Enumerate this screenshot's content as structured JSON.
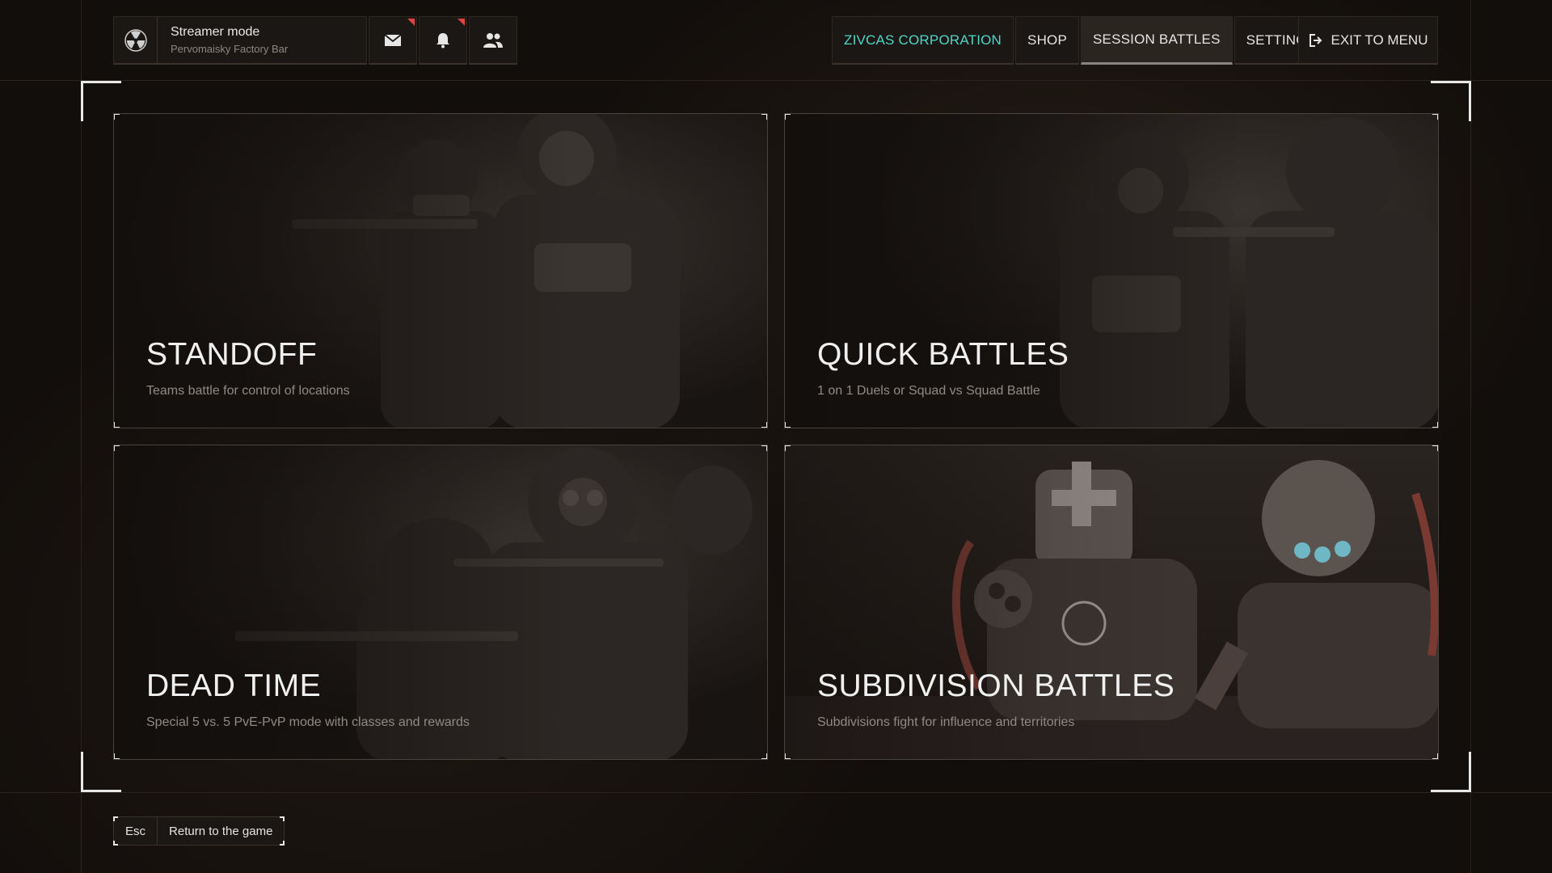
{
  "profile": {
    "name": "Streamer mode",
    "location": "Pervomaisky Factory Bar",
    "avatar_icon": "radiation-icon"
  },
  "header_icons": [
    {
      "name": "mail-icon",
      "has_notification": true
    },
    {
      "name": "bell-icon",
      "has_notification": true
    },
    {
      "name": "friends-icon",
      "has_notification": false
    }
  ],
  "nav": {
    "items": [
      {
        "label": "ZIVCAS CORPORATION",
        "accent": true
      },
      {
        "label": "SHOP"
      },
      {
        "label": "SESSION BATTLES",
        "active": true
      },
      {
        "label": "SETTINGS"
      }
    ],
    "exit_label": "EXIT TO MENU",
    "exit_icon": "exit-icon"
  },
  "modes": [
    {
      "title": "STANDOFF",
      "description": "Teams battle for control of locations"
    },
    {
      "title": "QUICK BATTLES",
      "description": "1 on 1 Duels or Squad vs Squad Battle"
    },
    {
      "title": "DEAD TIME",
      "description": "Special 5 vs. 5 PvE-PvP mode with classes and rewards"
    },
    {
      "title": "SUBDIVISION BATTLES",
      "description": "Subdivisions fight for influence and territories"
    }
  ],
  "footer": {
    "key": "Esc",
    "action": "Return to the game"
  },
  "colors": {
    "accent": "#4fd6c6",
    "notification": "#e0423b",
    "background": "#120e0b"
  }
}
